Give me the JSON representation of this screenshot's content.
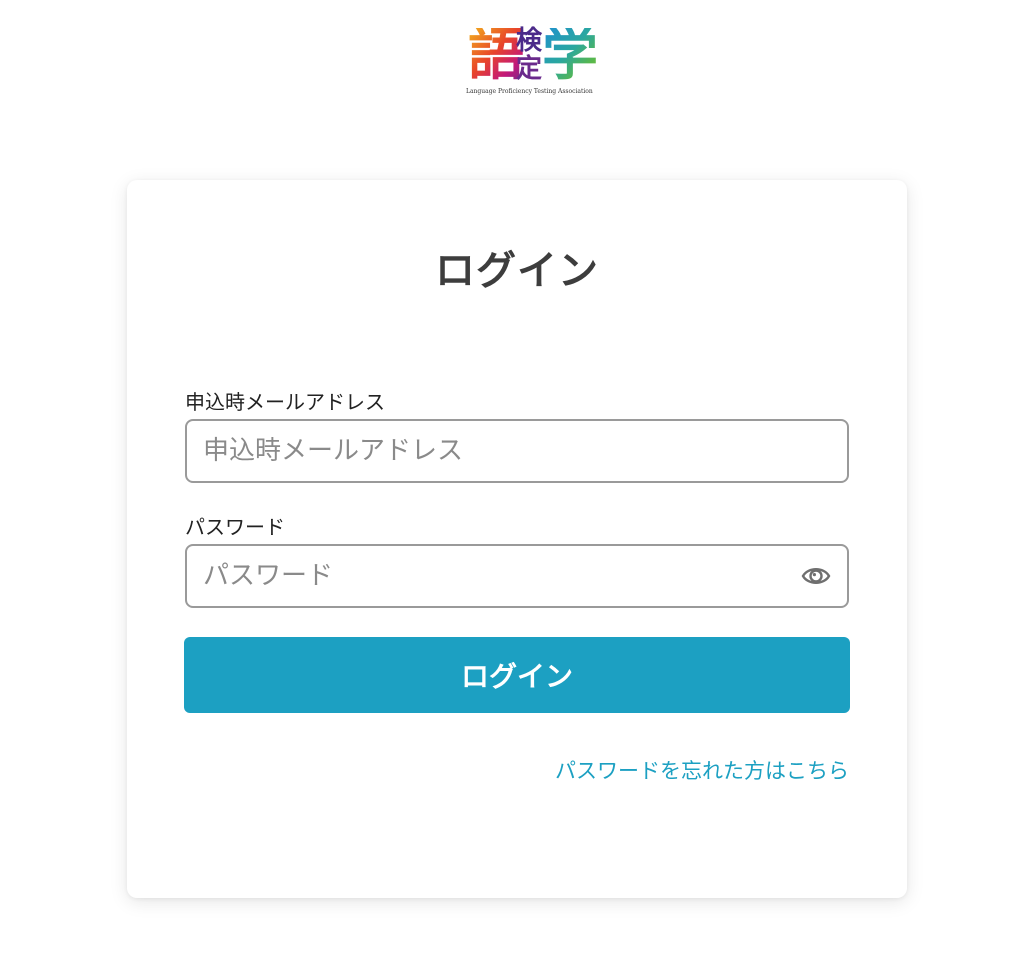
{
  "logo": {
    "char_main_left": "語",
    "char_small_top": "検",
    "char_small_bottom": "定",
    "char_main_right": "学",
    "subtitle": "Language Proficiency Testing Association"
  },
  "login_card": {
    "title": "ログイン",
    "email": {
      "label": "申込時メールアドレス",
      "placeholder": "申込時メールアドレス",
      "value": ""
    },
    "password": {
      "label": "パスワード",
      "placeholder": "パスワード",
      "value": "",
      "toggle_icon": "eye-icon"
    },
    "submit_label": "ログイン",
    "forgot_password_link": "パスワードを忘れた方はこちら"
  },
  "colors": {
    "accent": "#1ca0c2",
    "title_text": "#3d3d3d",
    "field_border": "#9a9a9a",
    "background": "#ffffff"
  }
}
